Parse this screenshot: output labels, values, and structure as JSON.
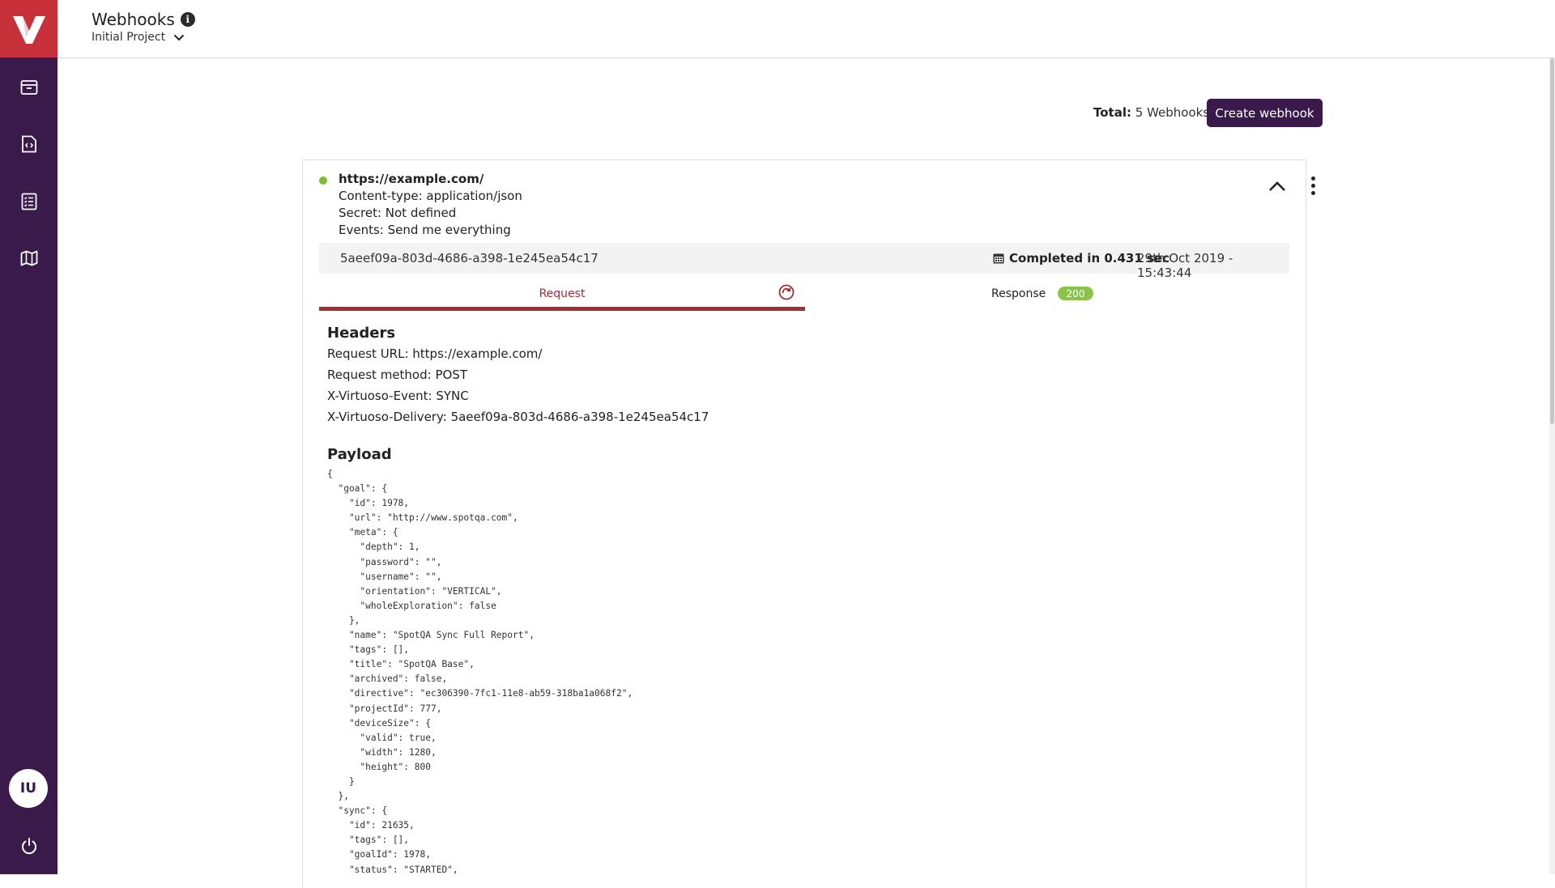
{
  "sidebar": {
    "logo_letter": "V",
    "items": [
      {
        "name": "archive-icon"
      },
      {
        "name": "code-file-icon"
      },
      {
        "name": "checklist-icon"
      },
      {
        "name": "map-icon"
      }
    ],
    "avatar_initials": "IU",
    "colors": {
      "sidebar_bg": "#3a1a4a",
      "logo_bg": "#c8303a"
    }
  },
  "header": {
    "title": "Webhooks",
    "info_icon": "i",
    "project": "Initial Project"
  },
  "toolbar": {
    "total_label": "Total:",
    "total_value": "5 Webhooks",
    "create_label": "Create webhook"
  },
  "webhook": {
    "url": "https://example.com/",
    "content_type": "Content-type: application/json",
    "secret": "Secret: Not defined",
    "events": "Events: Send me everything",
    "status_color": "#7dbb34",
    "delivery": {
      "id": "5aeef09a-803d-4686-a398-1e245ea54c17",
      "completed": "Completed in 0.431 sec",
      "date": "29th Oct 2019 - 15:43:44"
    },
    "tabs": {
      "request": "Request",
      "response": "Response",
      "response_code": "200"
    },
    "headers_title": "Headers",
    "headers": [
      "Request URL: https://example.com/",
      "Request method: POST",
      "X-Virtuoso-Event: SYNC",
      "X-Virtuoso-Delivery: 5aeef09a-803d-4686-a398-1e245ea54c17"
    ],
    "payload_title": "Payload",
    "payload": "{\n  \"goal\": {\n    \"id\": 1978,\n    \"url\": \"http://www.spotqa.com\",\n    \"meta\": {\n      \"depth\": 1,\n      \"password\": \"\",\n      \"username\": \"\",\n      \"orientation\": \"VERTICAL\",\n      \"wholeExploration\": false\n    },\n    \"name\": \"SpotQA Sync Full Report\",\n    \"tags\": [],\n    \"title\": \"SpotQA Base\",\n    \"archived\": false,\n    \"directive\": \"ec306390-7fc1-11e8-ab59-318ba1a068f2\",\n    \"projectId\": 777,\n    \"deviceSize\": {\n      \"valid\": true,\n      \"width\": 1280,\n      \"height\": 800\n    }\n  },\n  \"sync\": {\n    \"id\": 21635,\n    \"tags\": [],\n    \"goalId\": 1978,\n    \"status\": \"STARTED\","
  }
}
